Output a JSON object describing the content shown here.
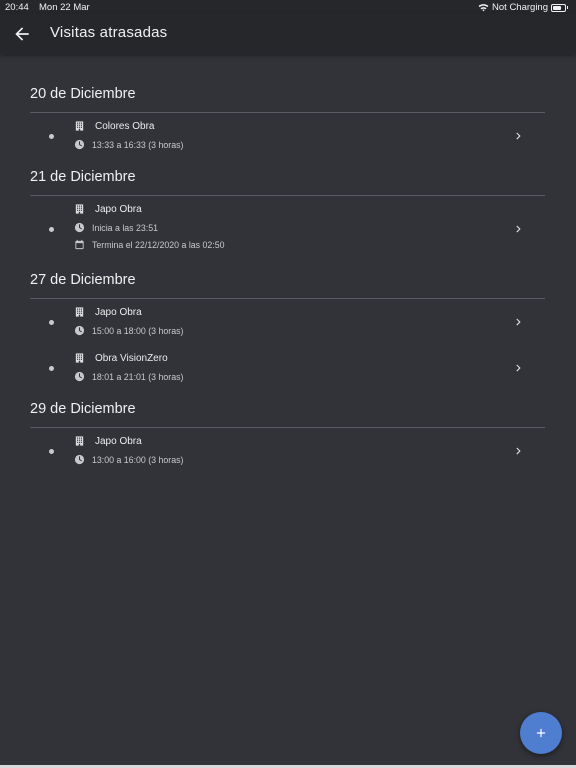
{
  "status_bar": {
    "time": "20:44",
    "date": "Mon 22 Mar",
    "charging": "Not Charging"
  },
  "app_bar": {
    "title": "Visitas atrasadas"
  },
  "sections": [
    {
      "header": "20 de Diciembre",
      "items": [
        {
          "name": "Colores Obra",
          "lines": [
            {
              "icon": "clock-icon",
              "text": "13:33 a 16:33 (3 horas)"
            }
          ]
        }
      ]
    },
    {
      "header": "21 de Diciembre",
      "items": [
        {
          "name": "Japo Obra",
          "lines": [
            {
              "icon": "clock-icon",
              "text": "Inicia a las 23:51"
            },
            {
              "icon": "calendar-icon",
              "text": "Termina el 22/12/2020 a las 02:50"
            }
          ]
        }
      ]
    },
    {
      "header": "27 de Diciembre",
      "items": [
        {
          "name": "Japo Obra",
          "lines": [
            {
              "icon": "clock-icon",
              "text": "15:00 a 18:00 (3 horas)"
            }
          ]
        },
        {
          "name": "Obra VisionZero",
          "lines": [
            {
              "icon": "clock-icon",
              "text": "18:01 a 21:01 (3 horas)"
            }
          ]
        }
      ]
    },
    {
      "header": "29 de Diciembre",
      "items": [
        {
          "name": "Japo Obra",
          "lines": [
            {
              "icon": "clock-icon",
              "text": "13:00 a 16:00 (3 horas)"
            }
          ]
        }
      ]
    }
  ],
  "fab": {
    "icon": "plus-icon"
  },
  "colors": {
    "background": "#323339",
    "app_bar": "#26272b",
    "accent": "#4f7dd0",
    "divider": "#5a5b62"
  }
}
